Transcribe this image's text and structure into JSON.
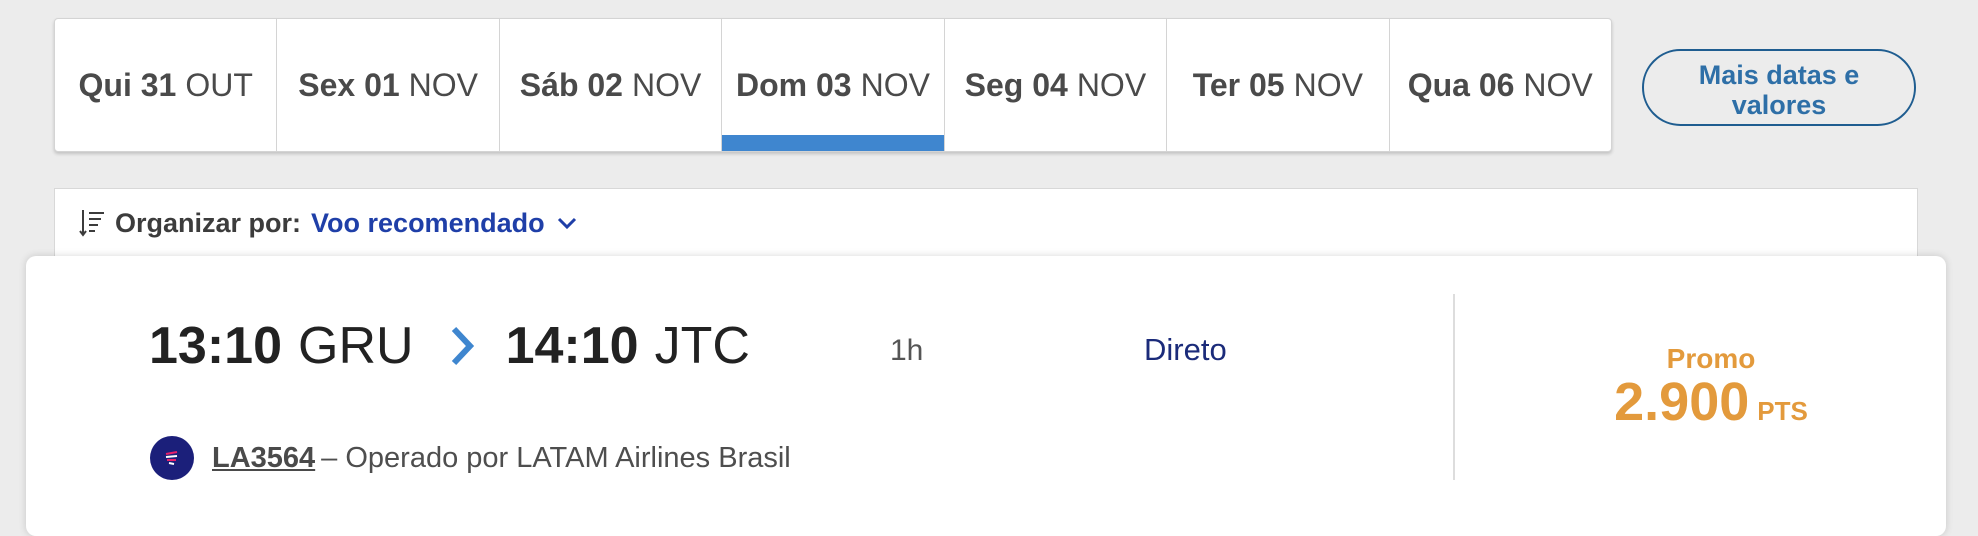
{
  "date_tabs": [
    {
      "day": "Qui 31",
      "month": "OUT",
      "selected": false
    },
    {
      "day": "Sex 01",
      "month": "NOV",
      "selected": false
    },
    {
      "day": "Sáb 02",
      "month": "NOV",
      "selected": false
    },
    {
      "day": "Dom 03",
      "month": "NOV",
      "selected": true
    },
    {
      "day": "Seg 04",
      "month": "NOV",
      "selected": false
    },
    {
      "day": "Ter 05",
      "month": "NOV",
      "selected": false
    },
    {
      "day": "Qua 06",
      "month": "NOV",
      "selected": false
    }
  ],
  "more_dates_label": "Mais datas e valores",
  "sort": {
    "label": "Organizar por:",
    "value": "Voo recomendado",
    "icon": "sort-icon"
  },
  "flight": {
    "departure_time": "13:10",
    "departure_airport": "GRU",
    "arrival_time": "14:10",
    "arrival_airport": "JTC",
    "duration": "1h",
    "stops": "Direto",
    "flight_number": "LA3564",
    "operated_by": "– Operado por LATAM Airlines Brasil",
    "promo_label": "Promo",
    "price": "2.900",
    "price_unit": "PTS"
  },
  "colors": {
    "accent_blue": "#3f86cf",
    "link_blue": "#1f3fa8",
    "promo_orange": "#e39a3c",
    "airline_navy": "#1b1f7a"
  }
}
